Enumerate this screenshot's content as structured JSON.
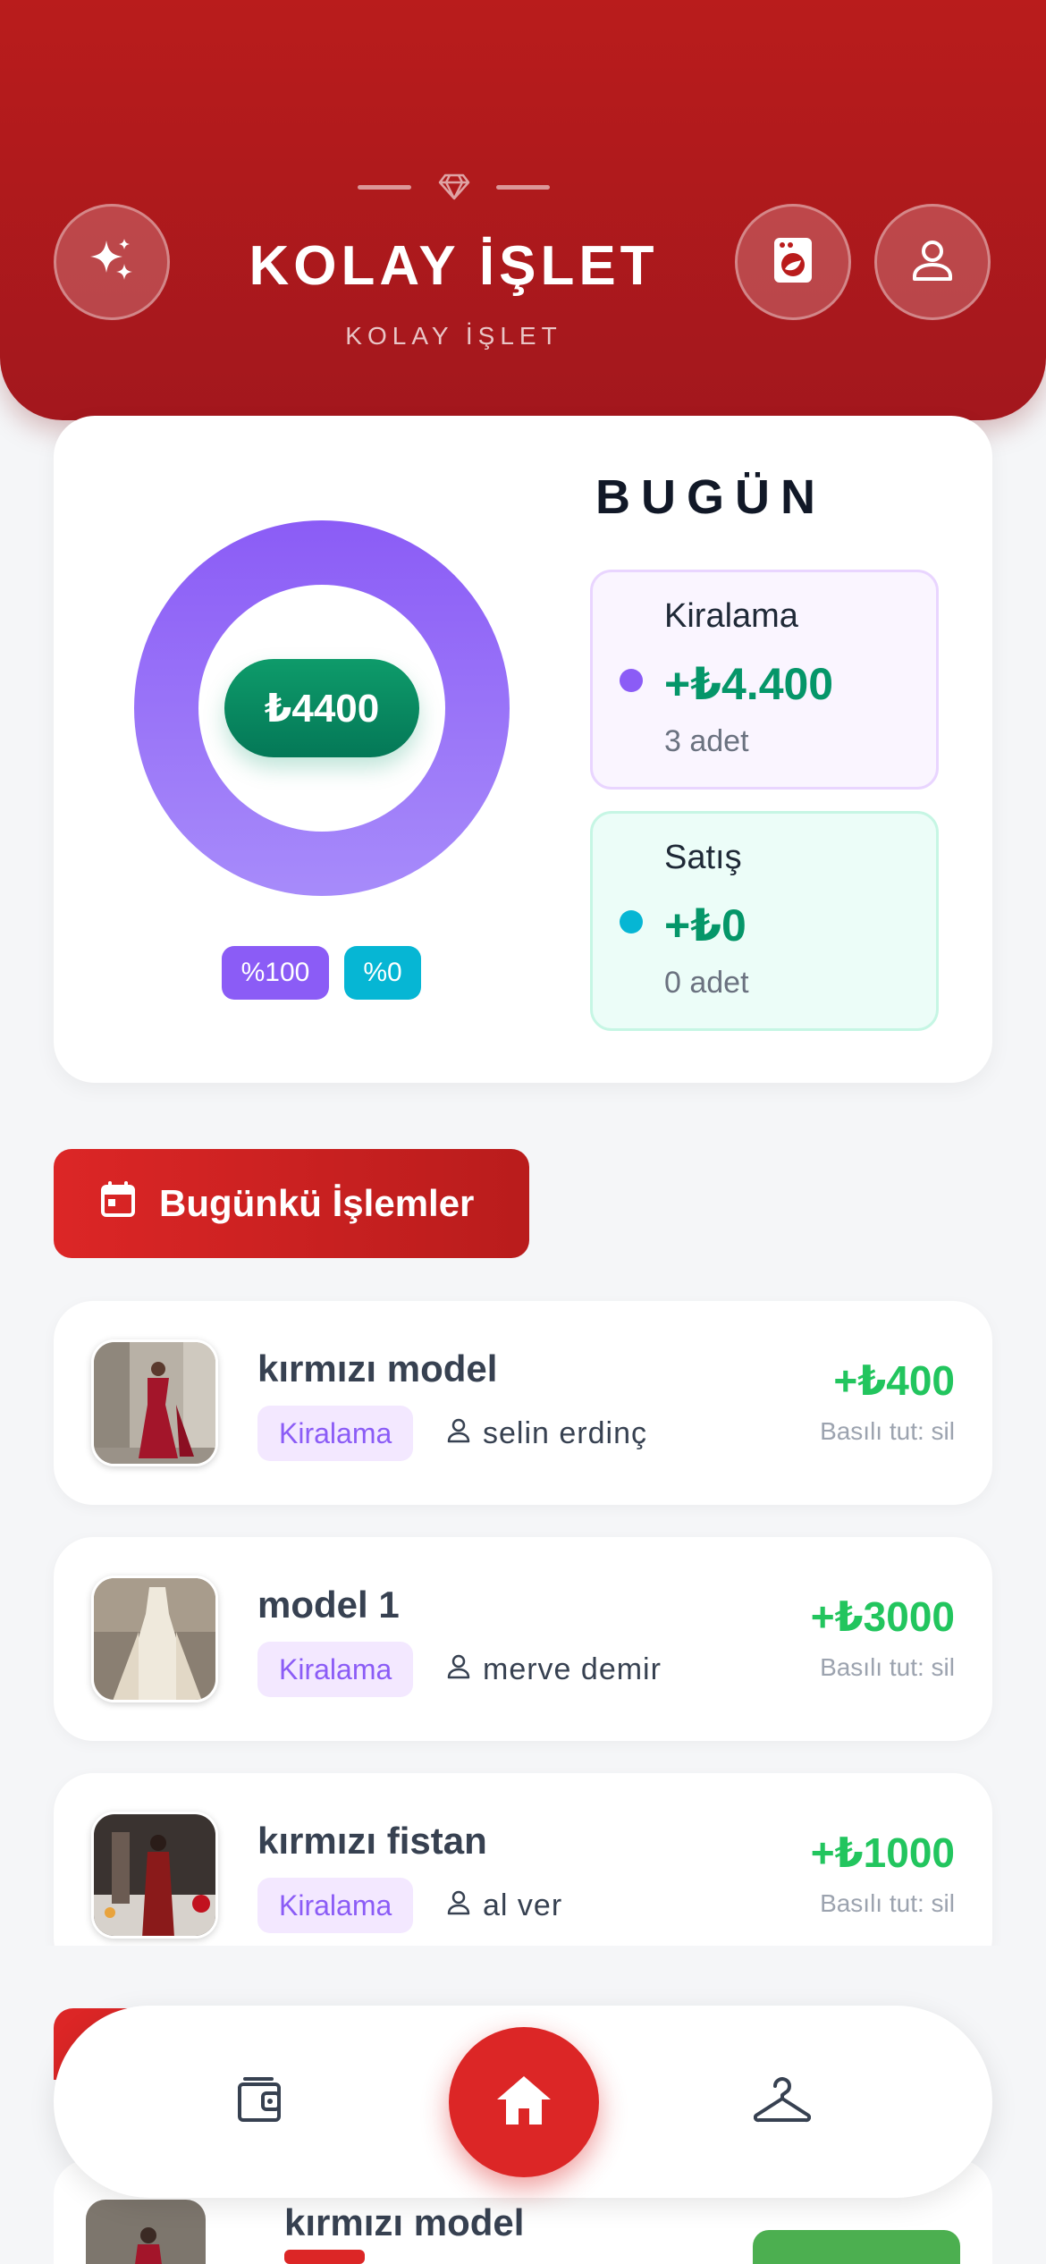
{
  "header": {
    "title": "KOLAY İŞLET",
    "subtitle": "KOLAY İŞLET",
    "left_button_icon": "sparkles-icon",
    "right_buttons": [
      "washing-machine-icon",
      "user-icon"
    ]
  },
  "summary": {
    "total": "₺4400",
    "percentages": [
      "%100",
      "%0"
    ],
    "heading": "BUGÜN",
    "stats": [
      {
        "label": "Kiralama",
        "amount": "+₺4.400",
        "count": "3 adet",
        "color": "#8b5cf6"
      },
      {
        "label": "Satış",
        "amount": "+₺0",
        "count": "0 adet",
        "color": "#06b6d4"
      }
    ]
  },
  "section": {
    "label": "Bugünkü İşlemler",
    "icon": "calendar-icon"
  },
  "transactions": [
    {
      "name": "kırmızı model",
      "tag": "Kiralama",
      "customer": "selin erdinç",
      "price": "+₺400",
      "hint": "Basılı tut: sil"
    },
    {
      "name": "model 1",
      "tag": "Kiralama",
      "customer": "merve demir",
      "price": "+₺3000",
      "hint": "Basılı tut: sil"
    },
    {
      "name": "kırmızı fistan",
      "tag": "Kiralama",
      "customer": "al ver",
      "price": "+₺1000",
      "hint": "Basılı tut: sil"
    }
  ],
  "peek_item": {
    "name": "kırmızı model"
  },
  "nav": {
    "items": [
      "wallet-icon",
      "home-icon",
      "hanger-icon"
    ]
  },
  "colors": {
    "brand_red": "#b91c1c",
    "accent_purple": "#8b5cf6",
    "accent_cyan": "#06b6d4",
    "money_green": "#059669"
  }
}
